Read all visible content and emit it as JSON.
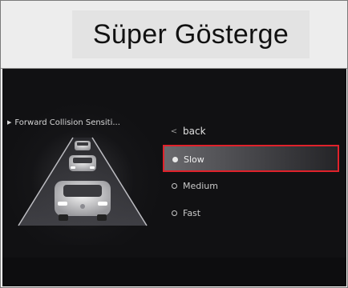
{
  "header": {
    "title": "Süper Gösterge"
  },
  "screen": {
    "section_label": "Forward Collision Sensiti...",
    "menu": {
      "back_label": "back",
      "options": [
        {
          "label": "Slow",
          "selected": true
        },
        {
          "label": "Medium",
          "selected": false
        },
        {
          "label": "Fast",
          "selected": false
        }
      ]
    }
  },
  "colors": {
    "highlight": "#e0222b",
    "screen_background": "#111113",
    "header_background": "#ededed"
  },
  "icons": {
    "section": "triangle-right-icon",
    "back": "chevron-left-icon",
    "option": "radio-icon"
  }
}
